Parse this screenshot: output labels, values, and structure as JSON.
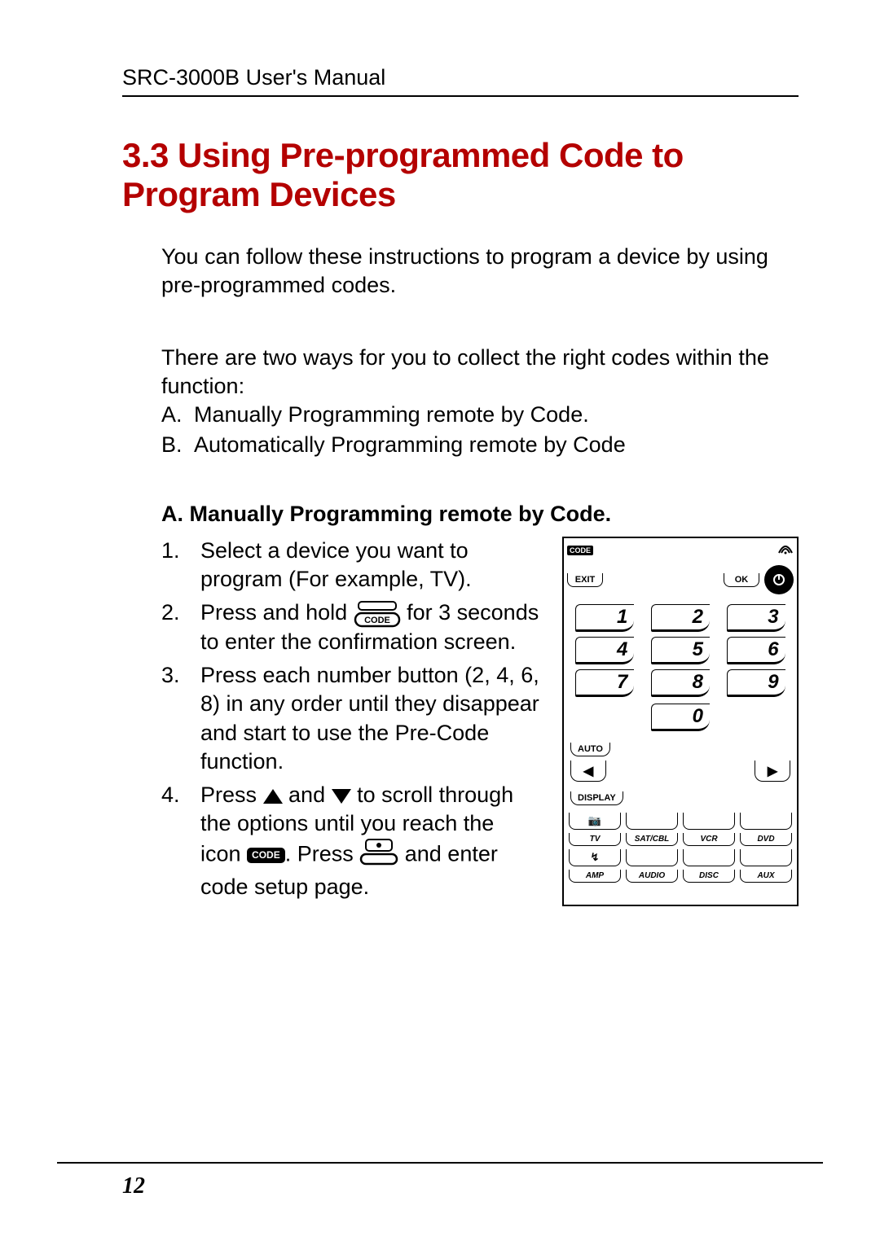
{
  "header": "SRC-3000B User's Manual",
  "section_title": "3.3 Using Pre-programmed Code to Program Devices",
  "intro": {
    "p1": "You can follow these instructions to program a device by using pre-programmed codes.",
    "p2": "There are two ways for you to collect the right codes within the function:",
    "ways": [
      {
        "marker": "A.",
        "text": "Manually Programming remote by Code."
      },
      {
        "marker": "B.",
        "text": "Automatically Programming remote by Code"
      }
    ]
  },
  "sub_heading": "A. Manually Programming remote by Code.",
  "steps": [
    {
      "num": "1.",
      "parts": [
        "Select a device you want to program (For example, TV)."
      ]
    },
    {
      "num": "2.",
      "parts": [
        "Press and hold ",
        "{CODE_BTN}",
        " for 3 seconds to enter the confirmation screen."
      ]
    },
    {
      "num": "3.",
      "parts": [
        "Press each number button   (2, 4, 6, 8) in any order until they disappear and start to use the Pre-Code function."
      ]
    },
    {
      "num": "4.",
      "parts": [
        "Press ",
        "{TRI_UP}",
        " and ",
        "{TRI_DOWN}",
        " to scroll through the options until you reach the icon ",
        "{CODE_PILL}",
        ". Press ",
        "{DOT_BTN}",
        " and enter code setup page."
      ]
    }
  ],
  "remote": {
    "code_label": "CODE",
    "exit": "EXIT",
    "ok": "OK",
    "numbers": [
      "1",
      "2",
      "3",
      "4",
      "5",
      "6",
      "7",
      "8",
      "9"
    ],
    "zero": "0",
    "auto": "AUTO",
    "display": "DISPLAY",
    "devices_row1": [
      "TV",
      "SAT/CBL",
      "VCR",
      "DVD"
    ],
    "devices_row2": [
      "AMP",
      "AUDIO",
      "DISC",
      "AUX"
    ],
    "cam_icon": "📷",
    "lamp_icon": "↯"
  },
  "page_number": "12",
  "icon_labels": {
    "code": "CODE",
    "code_pill": "CODE"
  }
}
